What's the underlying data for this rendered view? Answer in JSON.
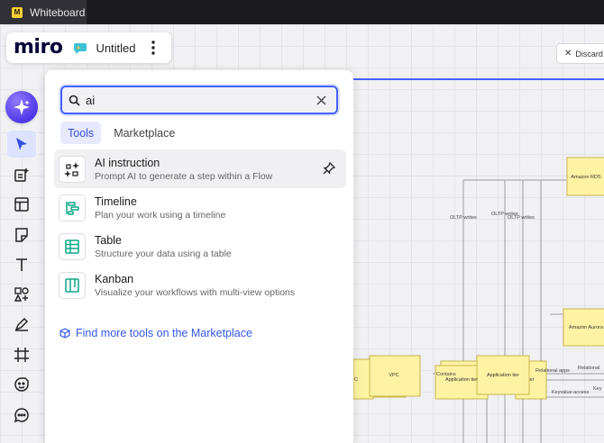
{
  "window": {
    "tab_label": "Whiteboard",
    "app_icon_letter": "M"
  },
  "board": {
    "logo": "miro",
    "title": "Untitled"
  },
  "discard": {
    "label": "Discard a"
  },
  "search": {
    "value": "ai",
    "placeholder": ""
  },
  "tabs": [
    {
      "label": "Tools",
      "active": true
    },
    {
      "label": "Marketplace",
      "active": false
    }
  ],
  "results": [
    {
      "title": "AI instruction",
      "description": "Prompt AI to generate a step within a Flow",
      "icon": "ai-instruction-icon",
      "pinned": true
    },
    {
      "title": "Timeline",
      "description": "Plan your work using a timeline",
      "icon": "timeline-icon",
      "color": "#0ca789"
    },
    {
      "title": "Table",
      "description": "Structure your data using a table",
      "icon": "table-icon",
      "color": "#0ca789"
    },
    {
      "title": "Kanban",
      "description": "Visualize your workflows with multi-view options",
      "icon": "kanban-icon",
      "color": "#0ca789"
    }
  ],
  "marketplace_link": {
    "label": "Find more tools on the Marketplace"
  },
  "toolbar": [
    "ai-assist-icon",
    "select-icon",
    "templates-icon",
    "frame-layout-icon",
    "sticky-note-icon",
    "text-icon",
    "shapes-icon",
    "pen-icon",
    "frame-icon",
    "stickers-icon",
    "comment-icon",
    "more-tools-icon"
  ],
  "diagram": {
    "labels": {
      "oltp1": "OLTP writes",
      "oltp2": "OLTP writes",
      "oltp3": "OLTP writes",
      "rds": "Amazon RDS",
      "aurora": "Amazon Aurora",
      "vpc": "VPC",
      "c_left": "C",
      "contains": "Contains",
      "app_tier_small": "Application tier",
      "app_tier": "Application tier",
      "er": "er",
      "relational_apps": "Relational apps",
      "relational_r": "Relational",
      "keyvalue": "Keyvalue access",
      "key_r": "Key"
    }
  },
  "colors": {
    "accent": "#4262ff",
    "note_fill": "#fff3a3",
    "note_stroke": "#c9b44a",
    "teal": "#0ca789"
  }
}
